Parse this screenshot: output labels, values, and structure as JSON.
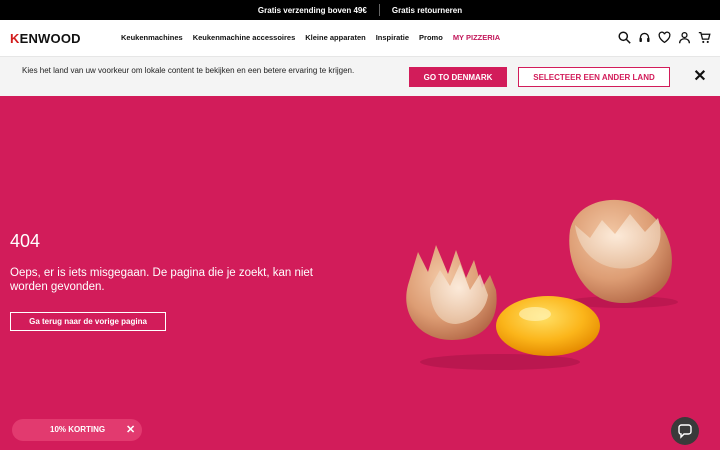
{
  "promo": {
    "left": "Gratis verzending boven 49€",
    "right": "Gratis retourneren"
  },
  "header": {
    "logo": "KENWOOD",
    "nav": [
      "Keukenmachines",
      "Keukenmachine accessoires",
      "Kleine apparaten",
      "Inspiratie",
      "Promo",
      "MY PIZZERIA"
    ],
    "icons": [
      "search-icon",
      "headset-icon",
      "heart-icon",
      "account-icon",
      "cart-icon"
    ]
  },
  "country": {
    "text": "Kies het land van uw voorkeur om lokale content te bekijken en een betere ervaring te krijgen.",
    "primary": "GO TO DENMARK",
    "secondary": "SELECTEER EEN ANDER LAND",
    "close": "✕"
  },
  "error": {
    "code": "404",
    "message": "Oeps, er is iets misgegaan. De pagina die je zoekt, kan niet worden gevonden.",
    "back": "Ga terug naar de vorige pagina"
  },
  "discount": {
    "label": "10% KORTING",
    "close": "✕"
  },
  "colors": {
    "brand": "#d21c5a",
    "black": "#000000",
    "bar": "#f4f4f4"
  }
}
